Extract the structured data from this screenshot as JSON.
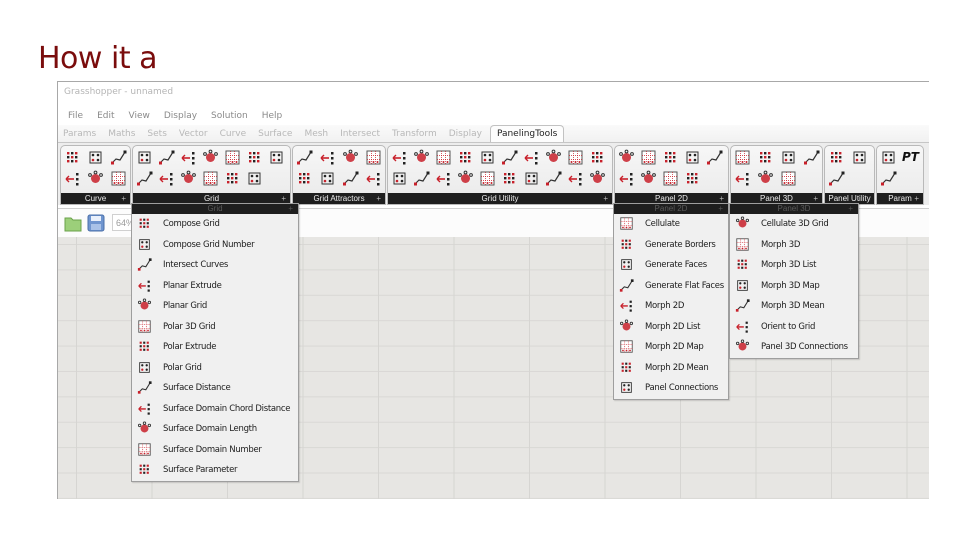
{
  "slide": {
    "title": "How it a"
  },
  "window": {
    "title": "Grasshopper - unnamed",
    "menu": [
      "File",
      "Edit",
      "View",
      "Display",
      "Solution",
      "Help"
    ],
    "tabs": [
      {
        "label": "Params",
        "active": false
      },
      {
        "label": "Maths",
        "active": false
      },
      {
        "label": "Sets",
        "active": false
      },
      {
        "label": "Vector",
        "active": false
      },
      {
        "label": "Curve",
        "active": false
      },
      {
        "label": "Surface",
        "active": false
      },
      {
        "label": "Mesh",
        "active": false
      },
      {
        "label": "Intersect",
        "active": false
      },
      {
        "label": "Transform",
        "active": false
      },
      {
        "label": "Display",
        "active": false
      },
      {
        "label": "PanelingTools",
        "active": true
      }
    ]
  },
  "ribbon": {
    "panels": [
      {
        "id": "curve",
        "label": "Curve",
        "icon_count": 6
      },
      {
        "id": "grid",
        "label": "Grid",
        "icon_count": 13
      },
      {
        "id": "grid-attractors",
        "label": "Grid Attractors",
        "icon_count": 8
      },
      {
        "id": "grid-utility",
        "label": "Grid Utility",
        "icon_count": 20
      },
      {
        "id": "panel-2d",
        "label": "Panel 2D",
        "icon_count": 9
      },
      {
        "id": "panel-3d",
        "label": "Panel 3D",
        "icon_count": 7
      },
      {
        "id": "panel-utility",
        "label": "Panel Utility",
        "icon_count": 3
      },
      {
        "id": "param",
        "label": "Param",
        "icon_count": 2,
        "extra_text": "PT"
      }
    ],
    "expand_symbol": "+"
  },
  "filebar": {
    "open_icon": "folder-open-icon",
    "save_icon": "floppy-save-icon",
    "zoom_value": "64%"
  },
  "dropdowns": {
    "grid": {
      "header": "Grid",
      "items": [
        {
          "label": "Compose Grid",
          "icon": "compose-grid-icon"
        },
        {
          "label": "Compose Grid Number",
          "icon": "compose-grid-number-icon"
        },
        {
          "label": "Intersect Curves",
          "icon": "intersect-curves-icon"
        },
        {
          "label": "Planar Extrude",
          "icon": "planar-extrude-icon"
        },
        {
          "label": "Planar Grid",
          "icon": "planar-grid-icon"
        },
        {
          "label": "Polar 3D Grid",
          "icon": "polar-3d-grid-icon"
        },
        {
          "label": "Polar Extrude",
          "icon": "polar-extrude-icon"
        },
        {
          "label": "Polar Grid",
          "icon": "polar-grid-icon"
        },
        {
          "label": "Surface Distance",
          "icon": "surface-distance-icon"
        },
        {
          "label": "Surface Domain Chord Distance",
          "icon": "surface-domain-chord-distance-icon"
        },
        {
          "label": "Surface Domain Length",
          "icon": "surface-domain-length-icon"
        },
        {
          "label": "Surface Domain Number",
          "icon": "surface-domain-number-icon"
        },
        {
          "label": "Surface Parameter",
          "icon": "surface-parameter-icon"
        }
      ]
    },
    "panel2d": {
      "header": "Panel 2D",
      "items": [
        {
          "label": "Cellulate",
          "icon": "cellulate-icon"
        },
        {
          "label": "Generate Borders",
          "icon": "generate-borders-icon"
        },
        {
          "label": "Generate Faces",
          "icon": "generate-faces-icon"
        },
        {
          "label": "Generate Flat Faces",
          "icon": "generate-flat-faces-icon"
        },
        {
          "label": "Morph 2D",
          "icon": "morph-2d-icon"
        },
        {
          "label": "Morph 2D List",
          "icon": "morph-2d-list-icon"
        },
        {
          "label": "Morph 2D Map",
          "icon": "morph-2d-map-icon"
        },
        {
          "label": "Morph 2D Mean",
          "icon": "morph-2d-mean-icon"
        },
        {
          "label": "Panel Connections",
          "icon": "panel-connections-icon"
        }
      ]
    },
    "panel3d": {
      "header": "Panel 3D",
      "items": [
        {
          "label": "Cellulate 3D Grid",
          "icon": "cellulate-3d-grid-icon"
        },
        {
          "label": "Morph 3D",
          "icon": "morph-3d-icon"
        },
        {
          "label": "Morph 3D List",
          "icon": "morph-3d-list-icon"
        },
        {
          "label": "Morph 3D Map",
          "icon": "morph-3d-map-icon"
        },
        {
          "label": "Morph 3D Mean",
          "icon": "morph-3d-mean-icon"
        },
        {
          "label": "Orient to Grid",
          "icon": "orient-to-grid-icon"
        },
        {
          "label": "Panel 3D Connections",
          "icon": "panel-3d-connections-icon"
        }
      ]
    }
  },
  "colors": {
    "title": "#7a0c0c",
    "accent_red": "#c8202a",
    "panel_label_bg": "#1e1e1e",
    "canvas_bg": "#e7e6e3"
  }
}
